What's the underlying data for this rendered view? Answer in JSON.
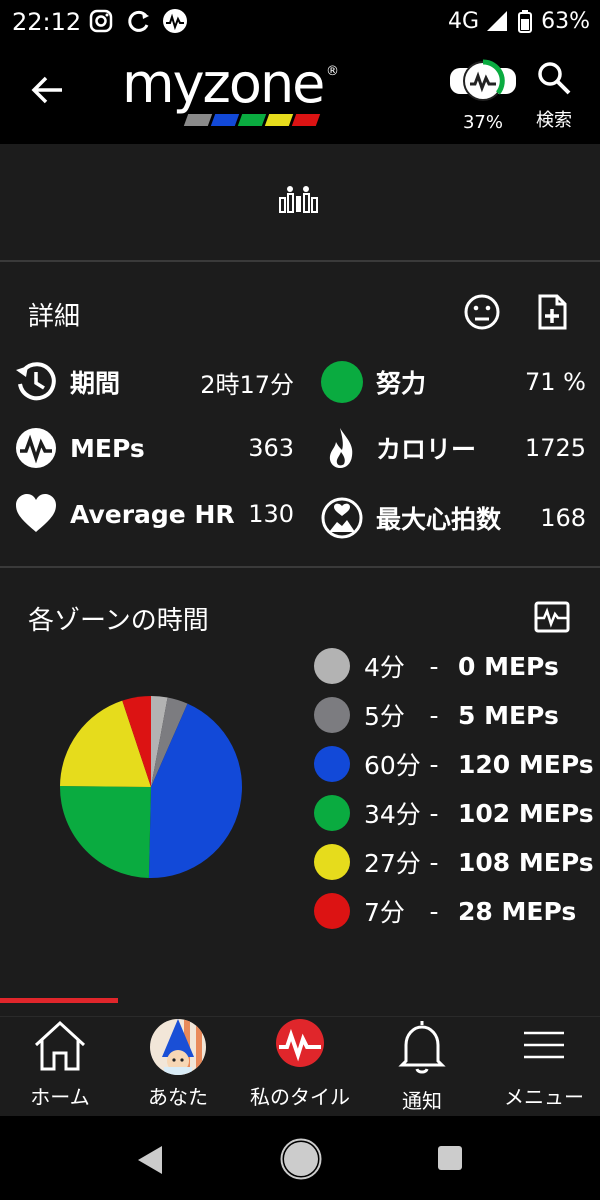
{
  "status_bar": {
    "time": "22:12",
    "network": "4G",
    "battery": "63%"
  },
  "header": {
    "logo_text": "myzone",
    "registered_mark": "®",
    "status_percent": "37%",
    "search_label": "検索"
  },
  "details": {
    "title": "詳細",
    "stats": [
      {
        "label": "期間",
        "value": "2時17分",
        "icon": "duration-icon"
      },
      {
        "label": "努力",
        "value": "71 %",
        "icon": "effort-dot-icon"
      },
      {
        "label": "MEPs",
        "value": "363",
        "icon": "meps-icon"
      },
      {
        "label": "カロリー",
        "value": "1725",
        "icon": "flame-icon"
      },
      {
        "label": "Average HR",
        "value": "130",
        "icon": "heart-icon"
      },
      {
        "label": "最大心拍数",
        "value": "168",
        "icon": "max-hr-icon"
      }
    ]
  },
  "zones": {
    "title": "各ゾーンの時間",
    "items": [
      {
        "minutes": "4分",
        "dash": "-",
        "meps": "0 MEPs",
        "color": "#b3b3b3",
        "value": 4
      },
      {
        "minutes": "5分",
        "dash": "-",
        "meps": "5 MEPs",
        "color": "#7c7c80",
        "value": 5
      },
      {
        "minutes": "60分",
        "dash": "-",
        "meps": "120 MEPs",
        "color": "#1249d8",
        "value": 60
      },
      {
        "minutes": "34分",
        "dash": "-",
        "meps": "102 MEPs",
        "color": "#0aab40",
        "value": 34
      },
      {
        "minutes": "27分",
        "dash": "-",
        "meps": "108 MEPs",
        "color": "#e6dc1c",
        "value": 27
      },
      {
        "minutes": "7分",
        "dash": "-",
        "meps": "28 MEPs",
        "color": "#dc1313",
        "value": 7
      }
    ]
  },
  "chart_data": {
    "type": "pie",
    "categories": [
      "4分",
      "5分",
      "60分",
      "34分",
      "27分",
      "7分"
    ],
    "values": [
      4,
      5,
      60,
      34,
      27,
      7
    ],
    "colors": [
      "#b3b3b3",
      "#7c7c80",
      "#1249d8",
      "#0aab40",
      "#e6dc1c",
      "#dc1313"
    ]
  },
  "nav": {
    "items": [
      {
        "label": "ホーム",
        "icon": "home-icon"
      },
      {
        "label": "あなた",
        "icon": "avatar"
      },
      {
        "label": "私のタイル",
        "icon": "my-tiles-icon"
      },
      {
        "label": "通知",
        "icon": "bell-icon"
      },
      {
        "label": "メニュー",
        "icon": "menu-icon"
      }
    ]
  },
  "colors": {
    "accent_red": "#e0262b",
    "panel": "#1c1c1c",
    "effort_green": "#0aab40"
  }
}
